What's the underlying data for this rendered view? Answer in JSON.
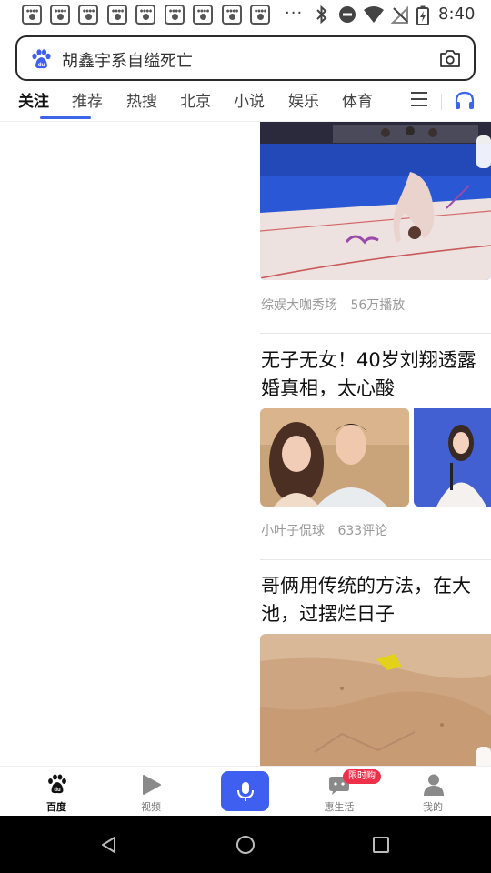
{
  "status_bar": {
    "notification_icons": [
      "baidu-paw",
      "baidu-paw",
      "baidu-paw",
      "baidu-paw",
      "baidu-paw",
      "baidu-paw",
      "baidu-paw",
      "baidu-paw",
      "baidu-paw"
    ],
    "overflow": "···",
    "time": "8:40"
  },
  "search": {
    "query": "胡鑫宇系自缢死亡"
  },
  "tabs": [
    {
      "label": "关注",
      "active": true
    },
    {
      "label": "推荐"
    },
    {
      "label": "热搜"
    },
    {
      "label": "北京"
    },
    {
      "label": "小说"
    },
    {
      "label": "娱乐"
    },
    {
      "label": "体育"
    }
  ],
  "feed": [
    {
      "source": "综娱大咖秀场",
      "stat": "56万播放"
    },
    {
      "title_line1": "无子无女！40岁刘翔透露",
      "title_line2": "婚真相，太心酸",
      "source": "小叶子侃球",
      "stat": "633评论"
    },
    {
      "title_line1": "哥俩用传统的方法，在大",
      "title_line2": "池，过摆烂日子"
    }
  ],
  "bottom_nav": {
    "items": [
      {
        "label": "百度",
        "icon": "baidu-paw-icon",
        "active": true
      },
      {
        "label": "视频",
        "icon": "play-icon"
      },
      {
        "label": "惠生活",
        "icon": "chat-bubble-icon"
      },
      {
        "label": "我的",
        "icon": "person-icon"
      }
    ],
    "badge": "限时购"
  },
  "colors": {
    "accent": "#3e64e8",
    "badge": "#f0304a"
  }
}
